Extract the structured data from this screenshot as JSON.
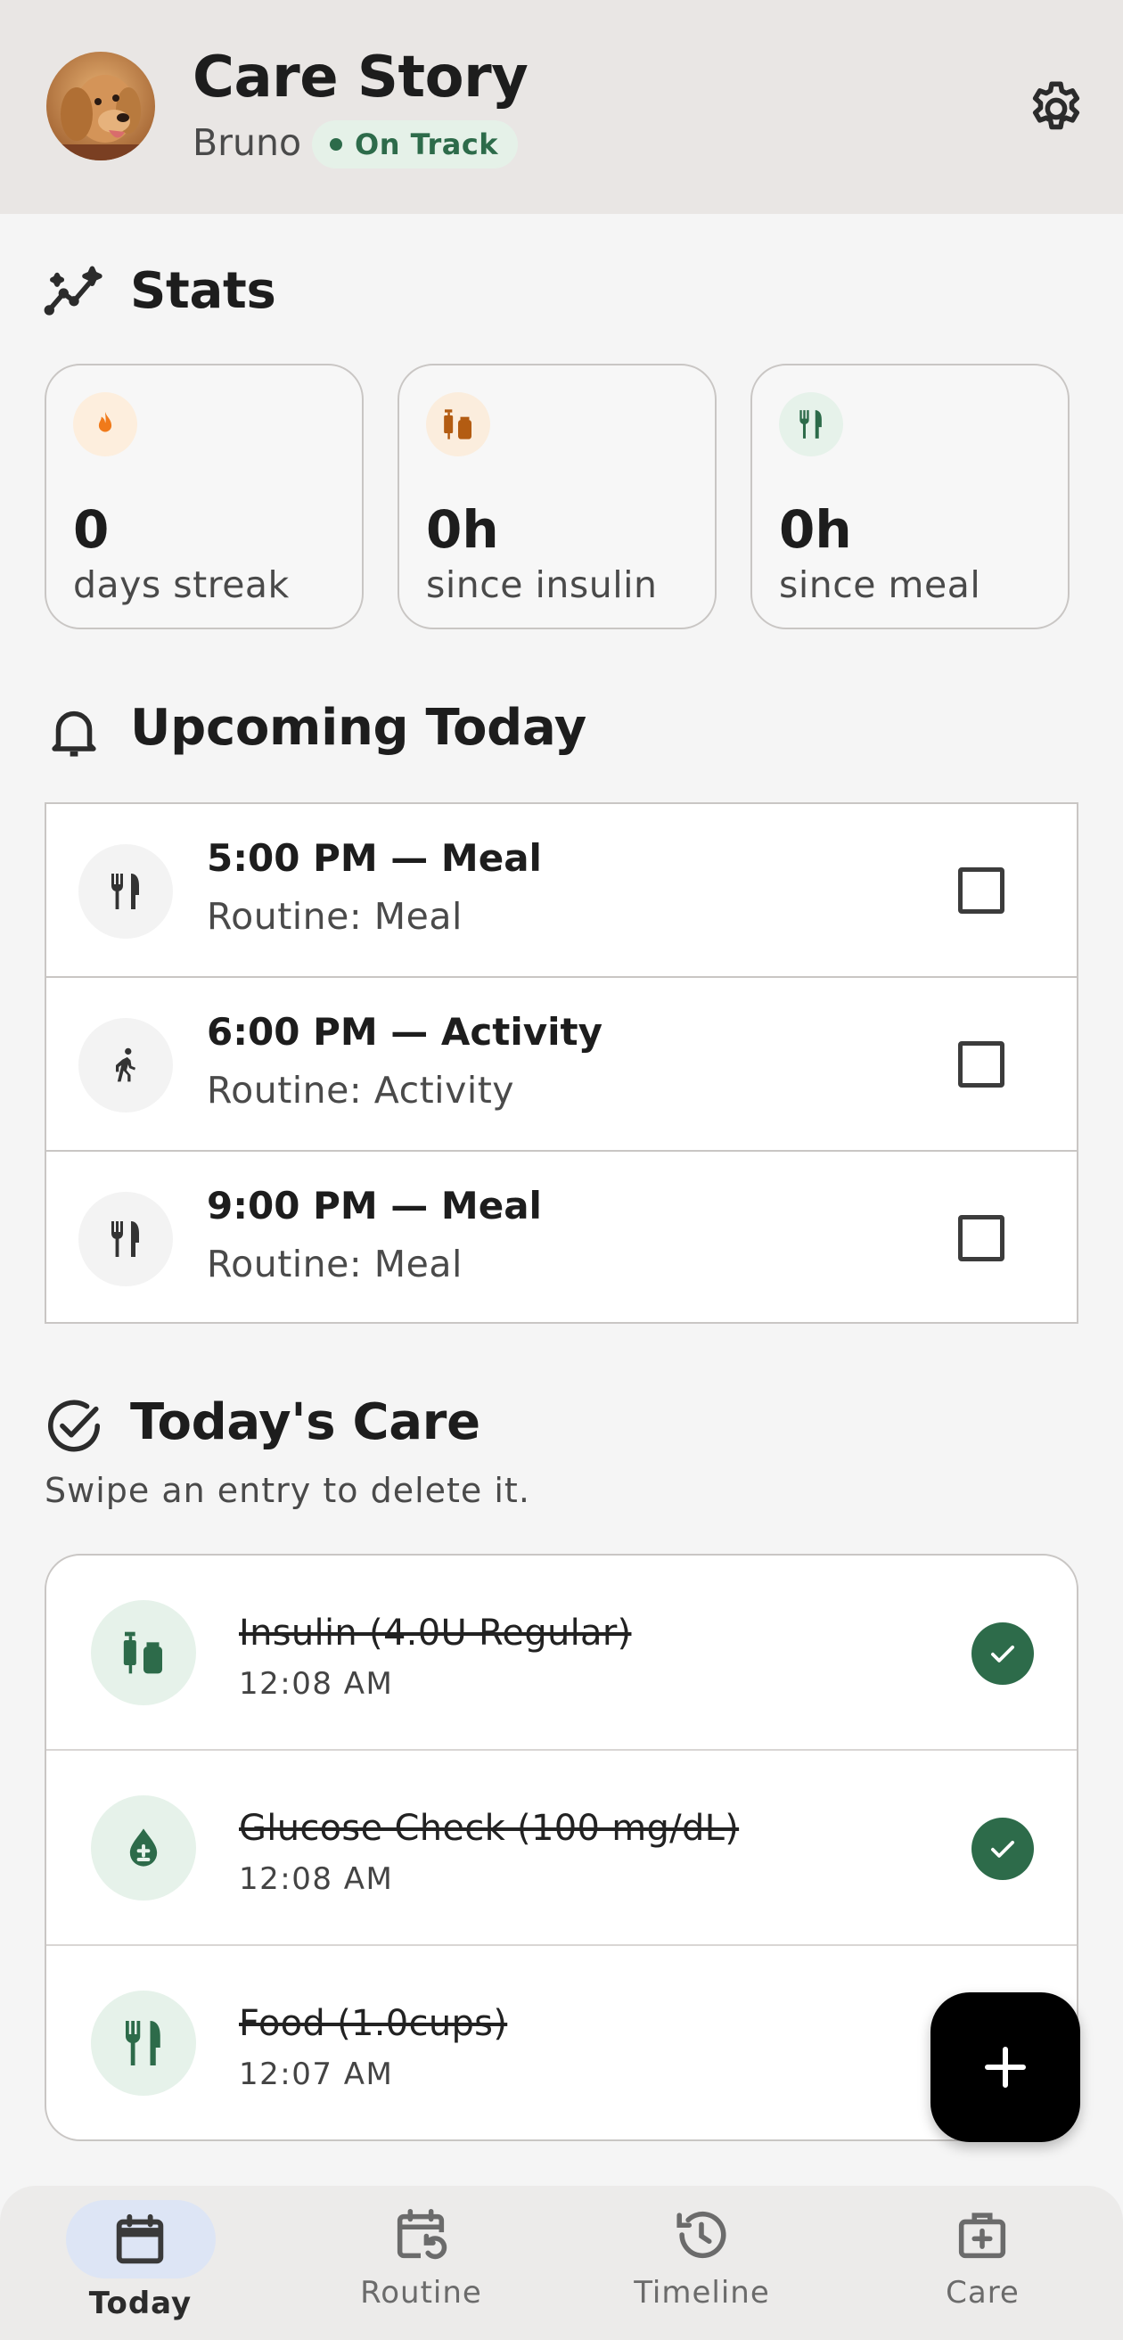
{
  "header": {
    "title": "Care Story",
    "pet_name": "Bruno",
    "status": "On Track"
  },
  "stats": {
    "title": "Stats",
    "cards": [
      {
        "value": "0",
        "label": "days streak",
        "icon": "flame-icon",
        "color": "#f07a1a"
      },
      {
        "value": "0h",
        "label": "since insulin",
        "icon": "syringe-vial-icon",
        "color": "#b35c12"
      },
      {
        "value": "0h",
        "label": "since meal",
        "icon": "fork-knife-icon",
        "color": "#2d6b4a"
      }
    ]
  },
  "upcoming": {
    "title": "Upcoming Today",
    "items": [
      {
        "title": "5:00 PM — Meal",
        "subtitle": "Routine: Meal",
        "icon": "fork-knife-icon"
      },
      {
        "title": "6:00 PM — Activity",
        "subtitle": "Routine: Activity",
        "icon": "walking-icon"
      },
      {
        "title": "9:00 PM — Meal",
        "subtitle": "Routine: Meal",
        "icon": "fork-knife-icon"
      }
    ]
  },
  "care": {
    "title": "Today's Care",
    "hint": "Swipe an entry to delete it.",
    "entries": [
      {
        "title": "Insulin (4.0U Regular)",
        "time": "12:08 AM",
        "icon": "syringe-vial-icon",
        "done": true
      },
      {
        "title": "Glucose Check (100 mg/dL)",
        "time": "12:08 AM",
        "icon": "blood-drop-icon",
        "done": true
      },
      {
        "title": "Food (1.0cups)",
        "time": "12:07 AM",
        "icon": "fork-knife-icon",
        "done": true
      }
    ]
  },
  "nav": {
    "items": [
      {
        "label": "Today",
        "icon": "calendar-icon",
        "active": true
      },
      {
        "label": "Routine",
        "icon": "calendar-repeat-icon",
        "active": false
      },
      {
        "label": "Timeline",
        "icon": "history-icon",
        "active": false
      },
      {
        "label": "Care",
        "icon": "medical-bag-icon",
        "active": false
      }
    ]
  },
  "colors": {
    "accent_green": "#2d6b4a",
    "header_bg": "#e9e6e4",
    "status_bg": "#e5f1e8",
    "nav_active_pill": "#dde5f5"
  }
}
